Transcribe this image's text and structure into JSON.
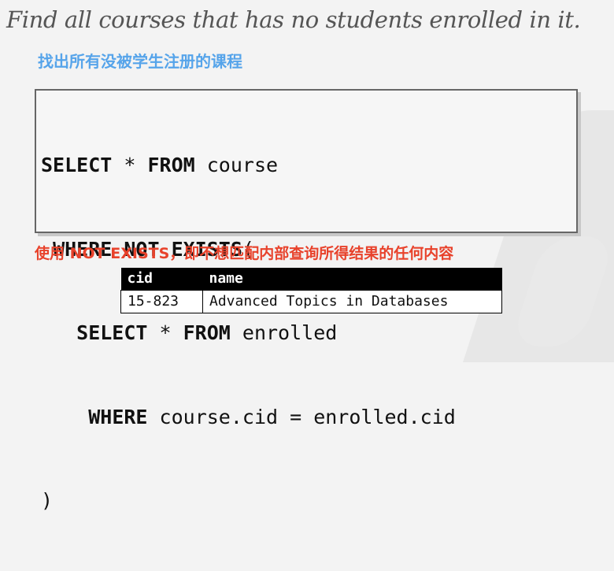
{
  "title": "Find all courses that has no students enrolled in it.",
  "subtitle_cn": "找出所有没被学生注册的课程",
  "sql": {
    "l1_kw1": "SELECT",
    "l1_t1": " * ",
    "l1_kw2": "FROM",
    "l1_t2": " course",
    "l2_indent": " ",
    "l2_kw1": "WHERE NOT EXISTS",
    "l2_t1": "(",
    "l3_indent": "   ",
    "l3_kw1": "SELECT",
    "l3_t1": " * ",
    "l3_kw2": "FROM",
    "l3_t2": " enrolled",
    "l4_indent": "    ",
    "l4_kw1": "WHERE",
    "l4_t1": " course.cid = enrolled.cid",
    "l5_t1": ")"
  },
  "note_cn": "使用 NOT EXISTS，即不想匹配内部查询所得结果的任何内容",
  "result_table": {
    "headers": [
      "cid",
      "name"
    ],
    "rows": [
      [
        "15-823",
        "Advanced Topics in Databases"
      ]
    ]
  }
}
